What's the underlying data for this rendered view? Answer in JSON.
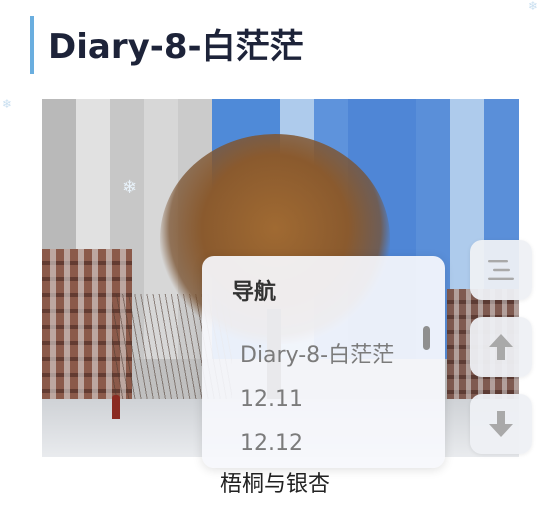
{
  "post": {
    "title": "Diary-8-白茫茫",
    "caption": "梧桐与银杏"
  },
  "navigation": {
    "heading": "导航",
    "items": [
      "Diary-8-白茫茫",
      "12.11",
      "12.12"
    ]
  },
  "side_buttons": {
    "menu_icon": "menu-lines-icon",
    "up_icon": "arrow-up-icon",
    "down_icon": "arrow-down-icon"
  },
  "colors": {
    "accent_bar": "#6aaedf",
    "title_text": "#1d2339",
    "button_icon": "#a9a9a9"
  }
}
